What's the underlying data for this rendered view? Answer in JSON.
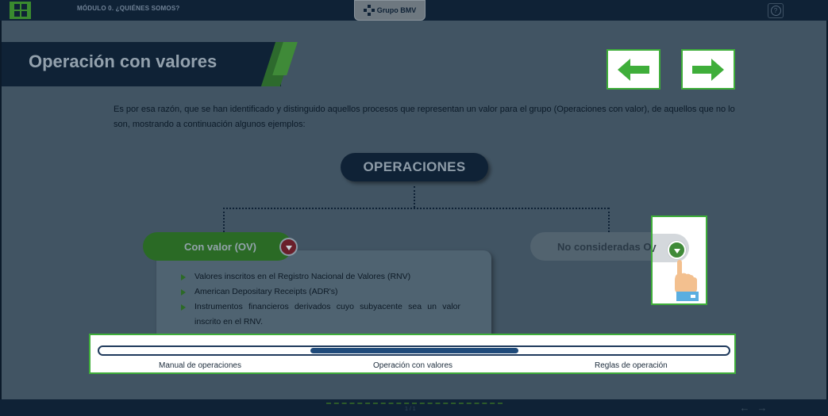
{
  "header": {
    "module_label": "MÓDULO 0. ¿QUIÉNES SOMOS?",
    "brand": "Grupo BMV",
    "menu_icon": "grid-menu-icon",
    "help_icon": "help-icon"
  },
  "page": {
    "title": "Operación con valores",
    "body": "Es por esa razón, que se han identificado y distinguido aquellos procesos que representan un valor para el grupo (Operaciones con valor), de aquellos que no lo son, mostrando a continuación algunos ejemplos:"
  },
  "nav": {
    "prev_icon": "arrow-left-icon",
    "next_icon": "arrow-right-icon"
  },
  "diagram": {
    "root": "OPERACIONES",
    "left_label": "Con valor (OV)",
    "right_label": "No consideradas OV",
    "hint_text": "V",
    "left_items": [
      "Valores inscritos en el Registro Nacional de Valores (RNV)",
      "American Depositary Receipts (ADR's)",
      "Instrumentos financieros derivados cuyo subyacente sea un valor inscrito en el RNV."
    ]
  },
  "progress": {
    "steps": [
      "Manual de operaciones",
      "Operación con valores",
      "Reglas de operación"
    ],
    "current_step": 2,
    "total_steps": 3
  },
  "footer": {
    "page_indicator": "1 / 1",
    "prev_symbol": "←",
    "next_symbol": "→"
  },
  "colors": {
    "accent_green": "#3fae3a",
    "dark_navy": "#0f2236",
    "progress_fill": "#1f4a7a"
  }
}
